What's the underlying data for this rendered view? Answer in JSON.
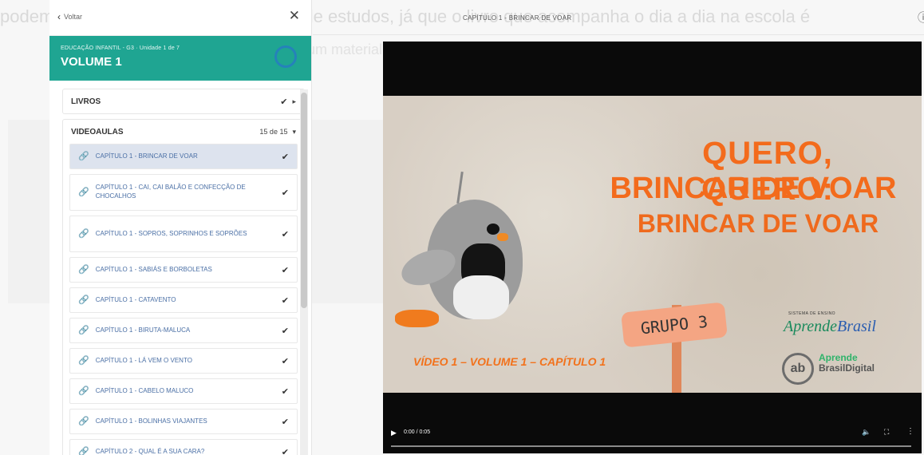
{
  "background": {
    "line1": "podem levar até o final da sua jornada de estudos, já que o livro que acompanha o dia a dia na escola é",
    "line2": "um material de apoio"
  },
  "sidebar": {
    "back_label": "Voltar",
    "close_icon": "close-icon",
    "banner": {
      "subtitle": "EDUCAÇÃO INFANTIL - G3 · Unidade 1 de 7",
      "title": "VOLUME 1",
      "color": "#1fa592"
    },
    "livros": {
      "label": "LIVROS"
    },
    "videoaulas": {
      "label": "VIDEOAULAS",
      "count": "15 de 15",
      "items": [
        {
          "label": "CAPÍTULO 1 - BRINCAR DE VOAR",
          "active": true
        },
        {
          "label": "CAPÍTULO 1 - CAI, CAI BALÃO E CONFECÇÃO DE CHOCALHOS"
        },
        {
          "label": "CAPÍTULO 1 - SOPROS, SOPRINHOS E SOPRÕES"
        },
        {
          "label": "CAPÍTULO 1 - SABIÁS E BORBOLETAS"
        },
        {
          "label": "CAPÍTULO 1 - CATAVENTO"
        },
        {
          "label": "CAPÍTULO 1 - BIRUTA-MALUCA"
        },
        {
          "label": "CAPÍTULO 1 - LÁ VEM O VENTO"
        },
        {
          "label": "CAPÍTULO 1 - CABELO MALUCO"
        },
        {
          "label": "CAPÍTULO 1 - BOLINHAS VIAJANTES"
        },
        {
          "label": "CAPÍTULO 2 - QUAL É A SUA CARA?"
        }
      ]
    }
  },
  "main": {
    "title": "CAPÍTULO 1 - BRINCAR DE VOAR",
    "video": {
      "title_line1": "QUERO, QUERO:",
      "title_line2": "BRINCAR DE VOAR",
      "title_line3": "BRINCAR DE VOAR",
      "caption": "VÍDEO 1 – VOLUME 1 – CAPÍTULO 1",
      "sign": "GRUPO 3",
      "system_label": "SISTEMA DE ENSINO",
      "brand_a": "Aprende",
      "brand_b": "Brasil",
      "ab_logo": "ab",
      "brand2_a": "Aprende",
      "brand2_b": "BrasilDigital",
      "time": "0:00 / 0:05",
      "progress": 0.0,
      "accent": "#f36b1c"
    }
  }
}
